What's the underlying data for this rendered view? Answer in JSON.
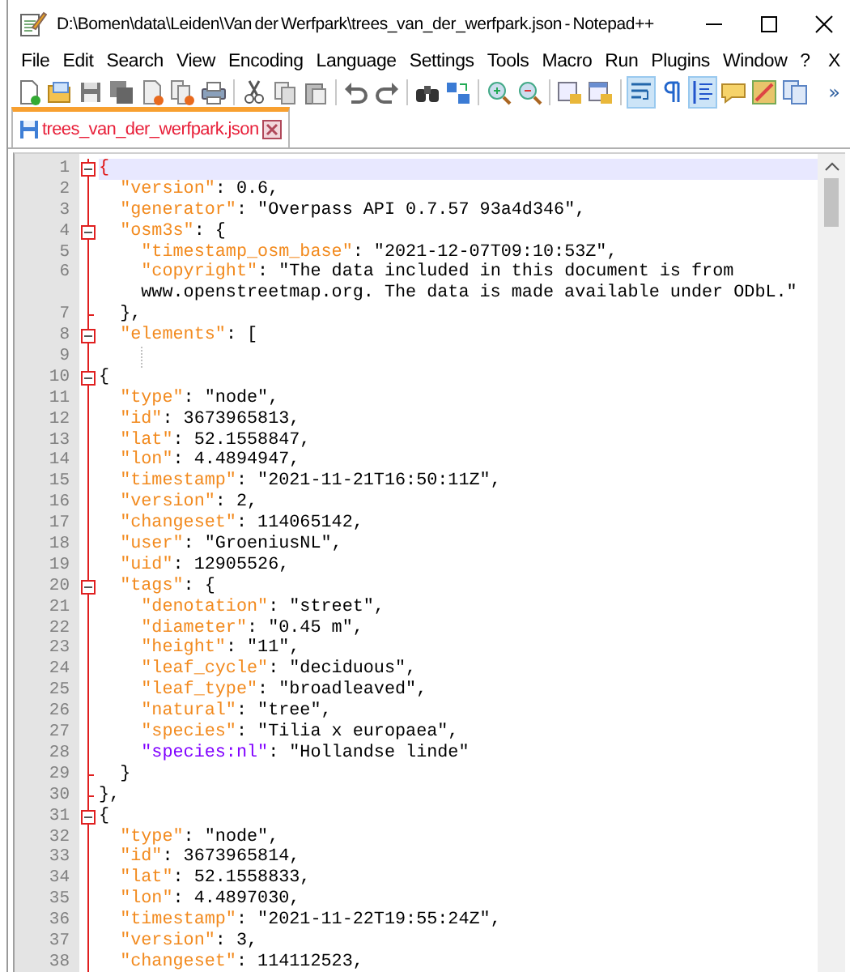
{
  "window": {
    "title": "D:\\Bomen\\data\\Leiden\\Van der Werfpark\\trees_van_der_werfpark.json - Notepad++"
  },
  "menu": [
    "File",
    "Edit",
    "Search",
    "View",
    "Encoding",
    "Language",
    "Settings",
    "Tools",
    "Macro",
    "Run",
    "Plugins",
    "Window",
    "?"
  ],
  "menu_close": "X",
  "toolbar": [
    {
      "kind": "new",
      "pressed": false
    },
    {
      "kind": "open",
      "pressed": false
    },
    {
      "kind": "save",
      "pressed": false
    },
    {
      "kind": "save-all",
      "pressed": false
    },
    {
      "kind": "close",
      "pressed": false
    },
    {
      "kind": "close-all",
      "pressed": false
    },
    {
      "kind": "print",
      "pressed": false
    },
    {
      "kind": "separator"
    },
    {
      "kind": "cut",
      "pressed": false
    },
    {
      "kind": "copy",
      "pressed": false
    },
    {
      "kind": "paste",
      "pressed": false
    },
    {
      "kind": "separator"
    },
    {
      "kind": "undo",
      "pressed": false
    },
    {
      "kind": "redo",
      "pressed": false
    },
    {
      "kind": "separator"
    },
    {
      "kind": "find",
      "pressed": false
    },
    {
      "kind": "replace",
      "pressed": false
    },
    {
      "kind": "separator"
    },
    {
      "kind": "zoom-in",
      "pressed": false
    },
    {
      "kind": "zoom-out",
      "pressed": false
    },
    {
      "kind": "separator"
    },
    {
      "kind": "sync-v",
      "pressed": false
    },
    {
      "kind": "sync-h",
      "pressed": false
    },
    {
      "kind": "separator"
    },
    {
      "kind": "wrap",
      "pressed": true
    },
    {
      "kind": "pilcrow",
      "pressed": false
    },
    {
      "kind": "indent-guide",
      "pressed": true
    },
    {
      "kind": "note",
      "pressed": false
    },
    {
      "kind": "map",
      "pressed": false
    },
    {
      "kind": "docs",
      "pressed": false
    }
  ],
  "toolbar_overflow": "»",
  "tabs": [
    {
      "label": "trees_van_der_werfpark.json",
      "selected": true
    }
  ],
  "editor": {
    "lines": [
      {
        "number": "1",
        "fold_open": true,
        "fold_end": false,
        "current": true,
        "segments": [
          {
            "kind": "brace",
            "text": "{"
          }
        ]
      },
      {
        "number": "2",
        "fold_open": false,
        "fold_end": false,
        "current": false,
        "segments": [
          {
            "kind": "key",
            "text": "  \"version\""
          },
          {
            "kind": "plain",
            "text": ": 0.6,"
          }
        ]
      },
      {
        "number": "3",
        "fold_open": false,
        "fold_end": false,
        "current": false,
        "segments": [
          {
            "kind": "key",
            "text": "  \"generator\""
          },
          {
            "kind": "plain",
            "text": ": \"Overpass API 0.7.57 93a4d346\","
          }
        ]
      },
      {
        "number": "4",
        "fold_open": true,
        "fold_end": false,
        "current": false,
        "segments": [
          {
            "kind": "key",
            "text": "  \"osm3s\""
          },
          {
            "kind": "plain",
            "text": ": {"
          }
        ]
      },
      {
        "number": "5",
        "fold_open": false,
        "fold_end": false,
        "current": false,
        "segments": [
          {
            "kind": "key",
            "text": "    \"timestamp_osm_base\""
          },
          {
            "kind": "plain",
            "text": ": \"2021-12-07T09:10:53Z\","
          }
        ]
      },
      {
        "number": "6",
        "fold_open": false,
        "fold_end": false,
        "current": false,
        "segments": [
          {
            "kind": "key",
            "text": "    \"copyright\""
          },
          {
            "kind": "plain",
            "text": ": \"The data included in this document is from"
          }
        ],
        "continuation": "    www.openstreetmap.org. The data is made available under ODbL.\""
      },
      {
        "number": "7",
        "fold_open": false,
        "fold_end": true,
        "current": false,
        "segments": [
          {
            "kind": "plain",
            "text": "  },"
          }
        ]
      },
      {
        "number": "8",
        "fold_open": true,
        "fold_end": false,
        "current": false,
        "segments": [
          {
            "kind": "key",
            "text": "  \"elements\""
          },
          {
            "kind": "plain",
            "text": ": ["
          }
        ]
      },
      {
        "number": "9",
        "fold_open": false,
        "fold_end": false,
        "current": false,
        "guide": true
      },
      {
        "number": "10",
        "fold_open": true,
        "fold_end": false,
        "current": false,
        "segments": [
          {
            "kind": "plain",
            "text": "{"
          }
        ]
      },
      {
        "number": "11",
        "fold_open": false,
        "fold_end": false,
        "current": false,
        "segments": [
          {
            "kind": "key",
            "text": "  \"type\""
          },
          {
            "kind": "plain",
            "text": ": \"node\","
          }
        ]
      },
      {
        "number": "12",
        "fold_open": false,
        "fold_end": false,
        "current": false,
        "segments": [
          {
            "kind": "key",
            "text": "  \"id\""
          },
          {
            "kind": "plain",
            "text": ": 3673965813,"
          }
        ]
      },
      {
        "number": "13",
        "fold_open": false,
        "fold_end": false,
        "current": false,
        "segments": [
          {
            "kind": "key",
            "text": "  \"lat\""
          },
          {
            "kind": "plain",
            "text": ": 52.1558847,"
          }
        ]
      },
      {
        "number": "14",
        "fold_open": false,
        "fold_end": false,
        "current": false,
        "segments": [
          {
            "kind": "key",
            "text": "  \"lon\""
          },
          {
            "kind": "plain",
            "text": ": 4.4894947,"
          }
        ]
      },
      {
        "number": "15",
        "fold_open": false,
        "fold_end": false,
        "current": false,
        "segments": [
          {
            "kind": "key",
            "text": "  \"timestamp\""
          },
          {
            "kind": "plain",
            "text": ": \"2021-11-21T16:50:11Z\","
          }
        ]
      },
      {
        "number": "16",
        "fold_open": false,
        "fold_end": false,
        "current": false,
        "segments": [
          {
            "kind": "key",
            "text": "  \"version\""
          },
          {
            "kind": "plain",
            "text": ": 2,"
          }
        ]
      },
      {
        "number": "17",
        "fold_open": false,
        "fold_end": false,
        "current": false,
        "segments": [
          {
            "kind": "key",
            "text": "  \"changeset\""
          },
          {
            "kind": "plain",
            "text": ": 114065142,"
          }
        ]
      },
      {
        "number": "18",
        "fold_open": false,
        "fold_end": false,
        "current": false,
        "segments": [
          {
            "kind": "key",
            "text": "  \"user\""
          },
          {
            "kind": "plain",
            "text": ": \"GroeniusNL\","
          }
        ]
      },
      {
        "number": "19",
        "fold_open": false,
        "fold_end": false,
        "current": false,
        "segments": [
          {
            "kind": "key",
            "text": "  \"uid\""
          },
          {
            "kind": "plain",
            "text": ": 12905526,"
          }
        ]
      },
      {
        "number": "20",
        "fold_open": true,
        "fold_end": false,
        "current": false,
        "segments": [
          {
            "kind": "key",
            "text": "  \"tags\""
          },
          {
            "kind": "plain",
            "text": ": {"
          }
        ]
      },
      {
        "number": "21",
        "fold_open": false,
        "fold_end": false,
        "current": false,
        "segments": [
          {
            "kind": "key",
            "text": "    \"denotation\""
          },
          {
            "kind": "plain",
            "text": ": \"street\","
          }
        ]
      },
      {
        "number": "22",
        "fold_open": false,
        "fold_end": false,
        "current": false,
        "segments": [
          {
            "kind": "key",
            "text": "    \"diameter\""
          },
          {
            "kind": "plain",
            "text": ": \"0.45 m\","
          }
        ]
      },
      {
        "number": "23",
        "fold_open": false,
        "fold_end": false,
        "current": false,
        "segments": [
          {
            "kind": "key",
            "text": "    \"height\""
          },
          {
            "kind": "plain",
            "text": ": \"11\","
          }
        ]
      },
      {
        "number": "24",
        "fold_open": false,
        "fold_end": false,
        "current": false,
        "segments": [
          {
            "kind": "key",
            "text": "    \"leaf_cycle\""
          },
          {
            "kind": "plain",
            "text": ": \"deciduous\","
          }
        ]
      },
      {
        "number": "25",
        "fold_open": false,
        "fold_end": false,
        "current": false,
        "segments": [
          {
            "kind": "key",
            "text": "    \"leaf_type\""
          },
          {
            "kind": "plain",
            "text": ": \"broadleaved\","
          }
        ]
      },
      {
        "number": "26",
        "fold_open": false,
        "fold_end": false,
        "current": false,
        "segments": [
          {
            "kind": "key",
            "text": "    \"natural\""
          },
          {
            "kind": "plain",
            "text": ": \"tree\","
          }
        ]
      },
      {
        "number": "27",
        "fold_open": false,
        "fold_end": false,
        "current": false,
        "segments": [
          {
            "kind": "key",
            "text": "    \"species\""
          },
          {
            "kind": "plain",
            "text": ": \"Tilia x europaea\","
          }
        ]
      },
      {
        "number": "28",
        "fold_open": false,
        "fold_end": false,
        "current": false,
        "segments": [
          {
            "kind": "namespaced-key",
            "text": "    \"species:nl\""
          },
          {
            "kind": "plain",
            "text": ": \"Hollandse linde\""
          }
        ]
      },
      {
        "number": "29",
        "fold_open": false,
        "fold_end": true,
        "current": false,
        "segments": [
          {
            "kind": "plain",
            "text": "  }"
          }
        ]
      },
      {
        "number": "30",
        "fold_open": false,
        "fold_end": true,
        "current": false,
        "segments": [
          {
            "kind": "plain",
            "text": "},"
          }
        ]
      },
      {
        "number": "31",
        "fold_open": true,
        "fold_end": false,
        "current": false,
        "segments": [
          {
            "kind": "plain",
            "text": "{"
          }
        ]
      },
      {
        "number": "32",
        "fold_open": false,
        "fold_end": false,
        "current": false,
        "segments": [
          {
            "kind": "key",
            "text": "  \"type\""
          },
          {
            "kind": "plain",
            "text": ": \"node\","
          }
        ]
      },
      {
        "number": "33",
        "fold_open": false,
        "fold_end": false,
        "current": false,
        "segments": [
          {
            "kind": "key",
            "text": "  \"id\""
          },
          {
            "kind": "plain",
            "text": ": 3673965814,"
          }
        ]
      },
      {
        "number": "34",
        "fold_open": false,
        "fold_end": false,
        "current": false,
        "segments": [
          {
            "kind": "key",
            "text": "  \"lat\""
          },
          {
            "kind": "plain",
            "text": ": 52.1558833,"
          }
        ]
      },
      {
        "number": "35",
        "fold_open": false,
        "fold_end": false,
        "current": false,
        "segments": [
          {
            "kind": "key",
            "text": "  \"lon\""
          },
          {
            "kind": "plain",
            "text": ": 4.4897030,"
          }
        ]
      },
      {
        "number": "36",
        "fold_open": false,
        "fold_end": false,
        "current": false,
        "segments": [
          {
            "kind": "key",
            "text": "  \"timestamp\""
          },
          {
            "kind": "plain",
            "text": ": \"2021-11-22T19:55:24Z\","
          }
        ]
      },
      {
        "number": "37",
        "fold_open": false,
        "fold_end": false,
        "current": false,
        "segments": [
          {
            "kind": "key",
            "text": "  \"version\""
          },
          {
            "kind": "plain",
            "text": ": 3,"
          }
        ]
      },
      {
        "number": "38",
        "fold_open": false,
        "fold_end": false,
        "current": false,
        "segments": [
          {
            "kind": "key",
            "text": "  \"changeset\""
          },
          {
            "kind": "plain",
            "text": ": 114112523,"
          }
        ]
      }
    ]
  }
}
